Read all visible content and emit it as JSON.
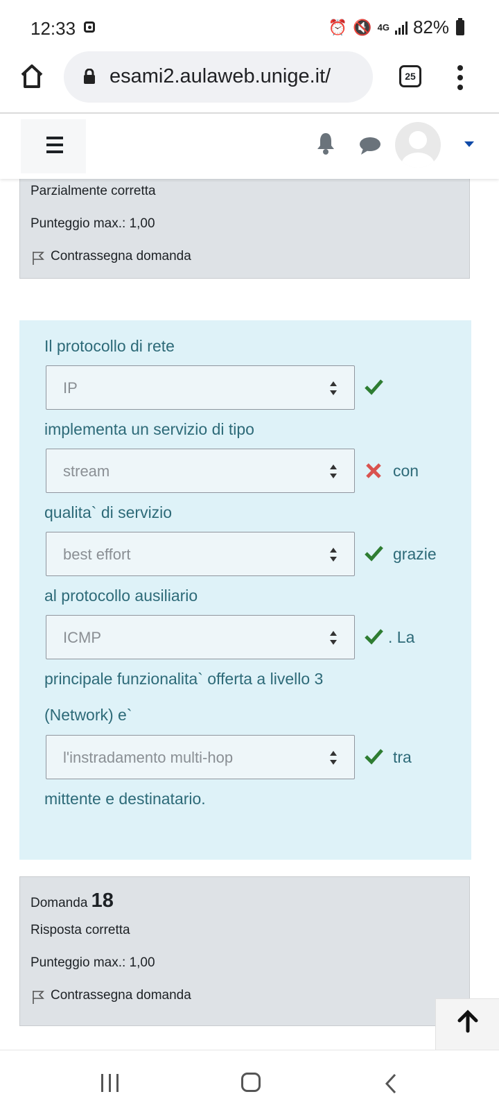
{
  "status_bar": {
    "time": "12:33",
    "network_label": "4G",
    "battery": "82%"
  },
  "browser": {
    "url": "esami2.aulaweb.unige.it/",
    "tab_count": "25"
  },
  "prev_question_info": {
    "status": "Parzialmente corretta",
    "max_score": "Punteggio max.: 1,00",
    "flag_label": "Contrassegna domanda"
  },
  "question": {
    "text_1": "Il protocollo di rete",
    "select_1": "IP",
    "text_2": "implementa un servizio di tipo",
    "select_2": "stream",
    "text_after_2": "con",
    "text_3": "qualita` di servizio",
    "select_3": "best effort",
    "text_after_3": "grazie",
    "text_4": "al protocollo ausiliario",
    "select_4": "ICMP",
    "text_after_4": ". La",
    "text_5": "principale funzionalita` offerta a livello 3",
    "text_6": "(Network) e`",
    "select_5": "l'instradamento multi-hop",
    "text_after_5": "tra",
    "text_7": "mittente e destinatario.",
    "marks": [
      "correct",
      "incorrect",
      "correct",
      "correct",
      "correct"
    ]
  },
  "next_question_info": {
    "label": "Domanda",
    "number": "18",
    "status": "Risposta corretta",
    "max_score": "Punteggio max.: 1,00",
    "flag_label": "Contrassegna domanda"
  },
  "colors": {
    "correct": "#2e7d32",
    "incorrect": "#d9534f",
    "question_bg": "#def2f8",
    "info_bg": "#dee2e6"
  },
  "icons": [
    "home-icon",
    "lock-icon",
    "tabs-icon",
    "more-vert-icon",
    "hamburger-icon",
    "bell-icon",
    "chat-icon",
    "avatar-icon",
    "flag-icon",
    "arrow-up-icon",
    "check-icon",
    "cross-icon"
  ]
}
